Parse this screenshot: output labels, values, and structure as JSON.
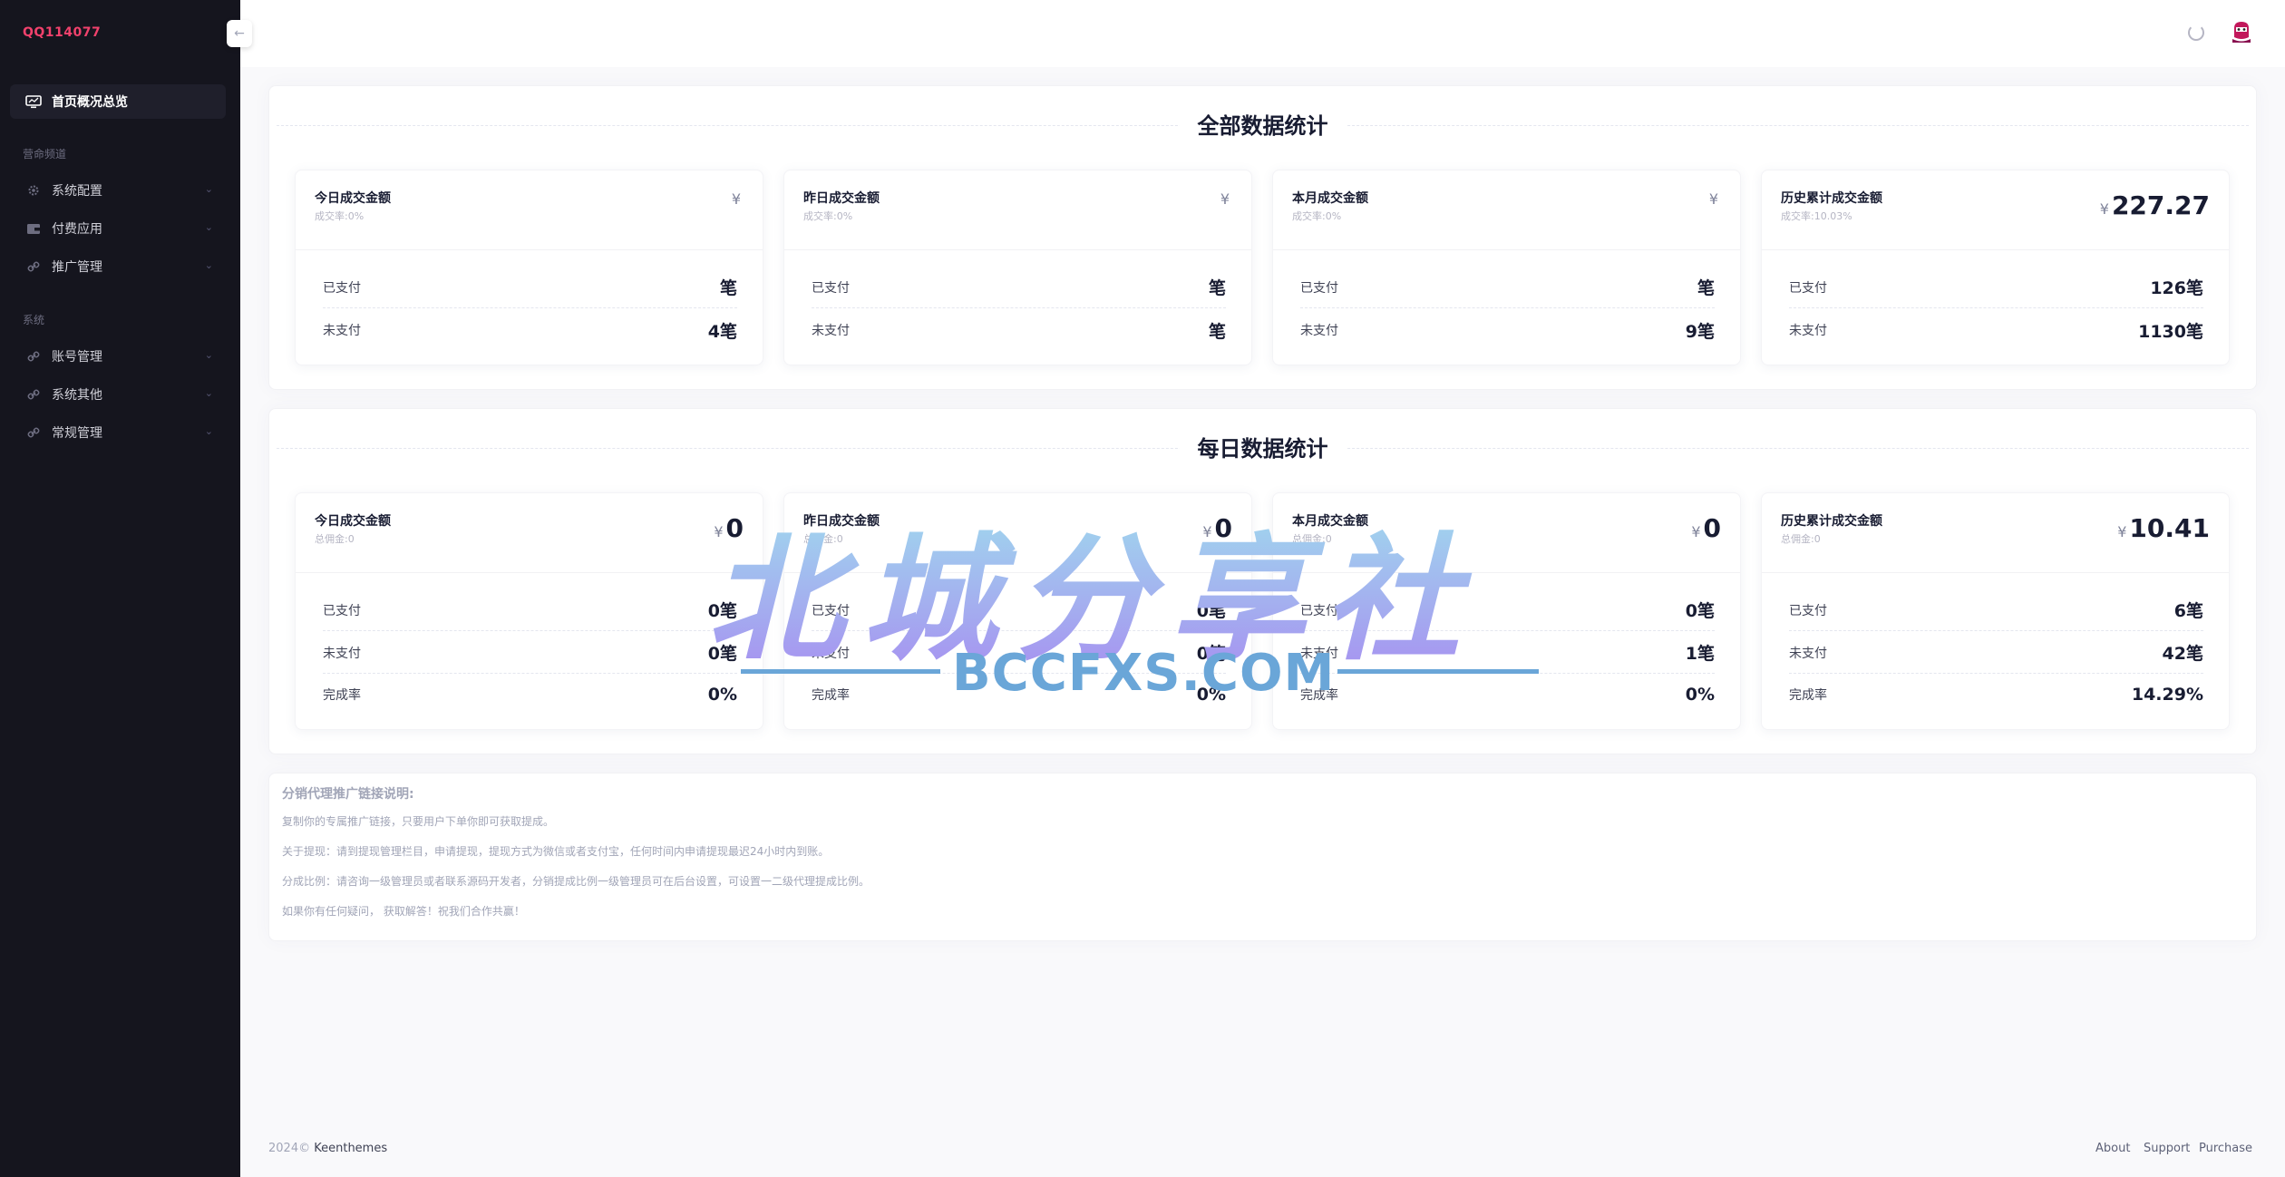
{
  "brand": "QQ114077",
  "sidebar": {
    "active": {
      "label": "首页概况总览",
      "icon": "monitor-icon"
    },
    "section1": "营命频道",
    "group1": [
      {
        "label": "系统配置",
        "icon": "gear-icon"
      },
      {
        "label": "付费应用",
        "icon": "wallet-icon"
      },
      {
        "label": "推广管理",
        "icon": "link-icon"
      }
    ],
    "section2": "系统",
    "group2": [
      {
        "label": "账号管理",
        "icon": "link-icon"
      },
      {
        "label": "系统其他",
        "icon": "link-icon"
      },
      {
        "label": "常规管理",
        "icon": "link-icon"
      }
    ]
  },
  "all_stats": {
    "title": "全部数据统计",
    "cards": [
      {
        "title": "今日成交金额",
        "sub": "成交率:0%",
        "currency": "¥",
        "amount": "",
        "rows": [
          {
            "label": "已支付",
            "value": "笔"
          },
          {
            "label": "未支付",
            "value": "4笔"
          }
        ]
      },
      {
        "title": "昨日成交金额",
        "sub": "成交率:0%",
        "currency": "¥",
        "amount": "",
        "rows": [
          {
            "label": "已支付",
            "value": "笔"
          },
          {
            "label": "未支付",
            "value": "笔"
          }
        ]
      },
      {
        "title": "本月成交金额",
        "sub": "成交率:0%",
        "currency": "¥",
        "amount": "",
        "rows": [
          {
            "label": "已支付",
            "value": "笔"
          },
          {
            "label": "未支付",
            "value": "9笔"
          }
        ]
      },
      {
        "title": "历史累计成交金额",
        "sub": "成交率:10.03%",
        "currency": "¥",
        "amount": "227.27",
        "rows": [
          {
            "label": "已支付",
            "value": "126笔"
          },
          {
            "label": "未支付",
            "value": "1130笔"
          }
        ]
      }
    ]
  },
  "daily_stats": {
    "title": "每日数据统计",
    "cards": [
      {
        "title": "今日成交金额",
        "sub": "总佣金:0",
        "currency": "¥",
        "amount": "0",
        "rows": [
          {
            "label": "已支付",
            "value": "0笔"
          },
          {
            "label": "未支付",
            "value": "0笔"
          },
          {
            "label": "完成率",
            "value": "0%"
          }
        ]
      },
      {
        "title": "昨日成交金额",
        "sub": "总佣金:0",
        "currency": "¥",
        "amount": "0",
        "rows": [
          {
            "label": "已支付",
            "value": "0笔"
          },
          {
            "label": "未支付",
            "value": "0笔"
          },
          {
            "label": "完成率",
            "value": "0%"
          }
        ]
      },
      {
        "title": "本月成交金额",
        "sub": "总佣金:0",
        "currency": "¥",
        "amount": "0",
        "rows": [
          {
            "label": "已支付",
            "value": "0笔"
          },
          {
            "label": "未支付",
            "value": "1笔"
          },
          {
            "label": "完成率",
            "value": "0%"
          }
        ]
      },
      {
        "title": "历史累计成交金额",
        "sub": "总佣金:0",
        "currency": "¥",
        "amount": "10.41",
        "rows": [
          {
            "label": "已支付",
            "value": "6笔"
          },
          {
            "label": "未支付",
            "value": "42笔"
          },
          {
            "label": "完成率",
            "value": "14.29%"
          }
        ]
      }
    ]
  },
  "notes": {
    "title": "分销代理推广链接说明:",
    "lines": [
      "复制你的专属推广链接，只要用户下单你即可获取提成。",
      "关于提现：请到提现管理栏目，申请提现，提现方式为微信或者支付宝，任何时间内申请提现最迟24小时内到账。",
      "分成比例：请咨询一级管理员或者联系源码开发者，分销提成比例一级管理员可在后台设置，可设置一二级代理提成比例。",
      "如果你有任何疑问， 获取解答！祝我们合作共赢！"
    ]
  },
  "footer": {
    "year": "2024©",
    "company": "Keenthemes",
    "links": [
      "About",
      "Support",
      "Purchase"
    ]
  },
  "watermark": {
    "cn": "北城分享社",
    "en": "BCCFXS.COM"
  }
}
